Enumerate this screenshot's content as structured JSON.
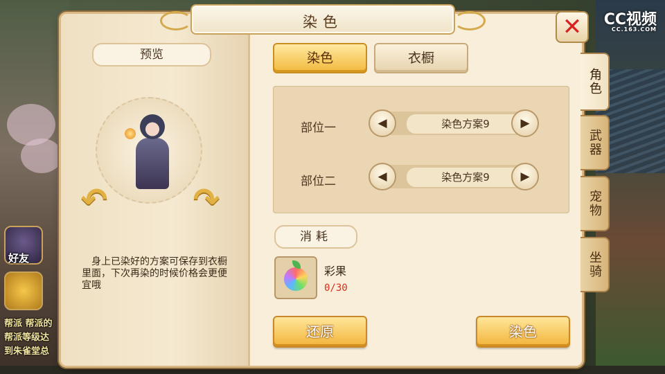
{
  "window": {
    "title": "染色"
  },
  "close_button": {
    "icon": "close-icon",
    "glyph": "✕"
  },
  "watermark": {
    "brand": "CC视频",
    "site": "CC.163.COM"
  },
  "preview": {
    "label": "预览",
    "description": "身上已染好的方案可保存到衣橱里面，下次再染的时候价格会更便宜哦"
  },
  "tabs": [
    {
      "label": "染色",
      "active": true
    },
    {
      "label": "衣橱",
      "active": false
    }
  ],
  "parts": [
    {
      "label": "部位一",
      "scheme": "染色方案9"
    },
    {
      "label": "部位二",
      "scheme": "染色方案9"
    }
  ],
  "cost": {
    "label": "消耗",
    "item_name": "彩果",
    "item_count": "0/30"
  },
  "actions": {
    "restore": "还原",
    "dye": "染色"
  },
  "side_tabs": [
    {
      "label": "角色",
      "active": true
    },
    {
      "label": "武器",
      "active": false
    },
    {
      "label": "宠物",
      "active": false
    },
    {
      "label": "坐骑",
      "active": false
    }
  ],
  "hud": {
    "friends_label": "好友",
    "chat_lines": [
      "帮派 帮派的",
      "帮派等级达",
      "到朱雀堂总"
    ]
  },
  "colors": {
    "accent": "#f2b93c",
    "close": "#d8221f",
    "count": "#d92d1e"
  }
}
